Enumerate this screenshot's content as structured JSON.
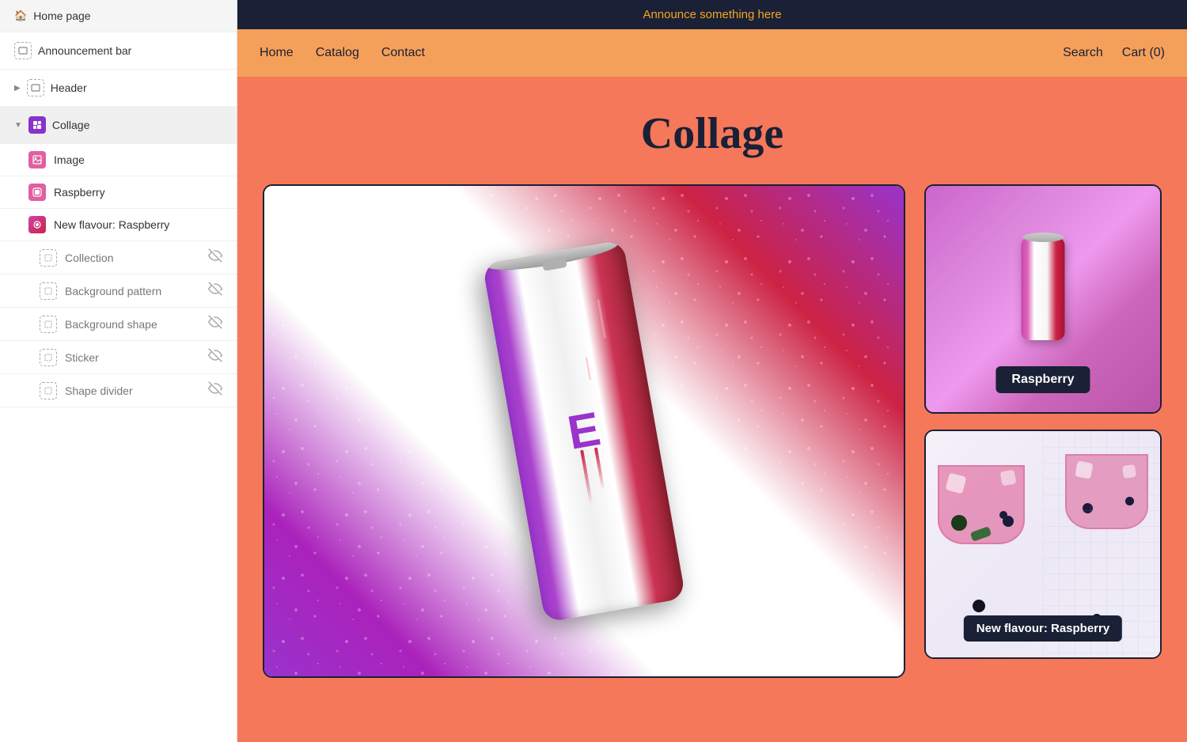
{
  "sidebar": {
    "home_page_label": "Home page",
    "items": [
      {
        "id": "announcement-bar",
        "label": "Announcement bar",
        "level": 0,
        "expandable": false,
        "icon": "announcement-icon"
      },
      {
        "id": "header",
        "label": "Header",
        "level": 0,
        "expandable": true,
        "icon": "header-icon"
      },
      {
        "id": "collage",
        "label": "Collage",
        "level": 0,
        "expandable": true,
        "icon": "collage-icon",
        "active": true
      },
      {
        "id": "image",
        "label": "Image",
        "level": 1,
        "icon": "image-icon"
      },
      {
        "id": "raspberry",
        "label": "Raspberry",
        "level": 1,
        "icon": "raspberry-icon"
      },
      {
        "id": "new-flavour-raspberry",
        "label": "New flavour: Raspberry",
        "level": 1,
        "icon": "flavour-icon"
      },
      {
        "id": "collection",
        "label": "Collection",
        "level": 2,
        "hidden": true,
        "icon": "dashed-icon"
      },
      {
        "id": "background-pattern",
        "label": "Background pattern",
        "level": 2,
        "hidden": true,
        "icon": "dashed-icon"
      },
      {
        "id": "background-shape",
        "label": "Background shape",
        "level": 2,
        "hidden": true,
        "icon": "dashed-icon"
      },
      {
        "id": "sticker",
        "label": "Sticker",
        "level": 2,
        "hidden": true,
        "icon": "dashed-icon"
      },
      {
        "id": "shape-divider",
        "label": "Shape divider",
        "level": 2,
        "hidden": true,
        "icon": "dashed-icon"
      }
    ]
  },
  "announcement_bar": {
    "text": "Announce something here",
    "bg_color": "#1a2035",
    "text_color": "#f5a623"
  },
  "nav": {
    "links": [
      "Home",
      "Catalog",
      "Contact"
    ],
    "right_items": [
      "Search",
      "Cart (0)"
    ],
    "bg_color": "#f5a05a"
  },
  "page": {
    "title": "Collage",
    "bg_color": "#f5785a"
  },
  "collage": {
    "card1_label": "Raspberry",
    "card2_label": "New flavour: Raspberry"
  }
}
